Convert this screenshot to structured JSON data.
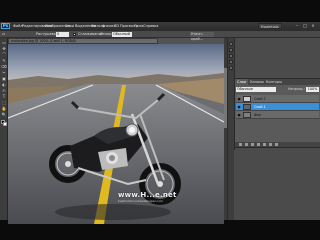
{
  "app": {
    "logo": "Ps",
    "workspace": "Essentials",
    "menu": [
      "Файл",
      "Редактирование",
      "Изображение",
      "Слои",
      "Выделение",
      "Фильтр",
      "Анализ",
      "3D",
      "Просмотр",
      "Окно",
      "Справка"
    ],
    "window_controls": [
      "–",
      "□",
      "×"
    ]
  },
  "options_bar": {
    "feather_label": "Растушевка:",
    "feather_value": "0 пикс",
    "antialias_label": "Сглаживание",
    "style_label": "Стиль:",
    "style_value": "Обычный",
    "refine_button": "Уточн. край..."
  },
  "document": {
    "tab_title": "motorbike.jpg @ 100% (Слой 1, RGB/8)"
  },
  "tools": [
    "▭",
    "✥",
    "⌒",
    "✎",
    "⌫",
    "✂",
    "▣",
    "◐",
    "✍",
    "T",
    "⬚",
    "✋",
    "🔍"
  ],
  "colors": {
    "foreground": "#000000",
    "background": "#ffffff",
    "accent": "#3b8fd6"
  },
  "layers_panel": {
    "tabs": [
      "Слои",
      "Каналы",
      "Контуры"
    ],
    "blend_mode": "Обычные",
    "opacity_label": "Непрозр.:",
    "opacity_value": "100%",
    "layers": [
      {
        "name": "Слой 2",
        "selected": false
      },
      {
        "name": "Слой 1",
        "selected": true
      },
      {
        "name": "Фон",
        "selected": false
      }
    ]
  },
  "watermark": {
    "text": "www.H...e.net",
    "subtext": "bestmotorcyclewallpaper.com"
  }
}
